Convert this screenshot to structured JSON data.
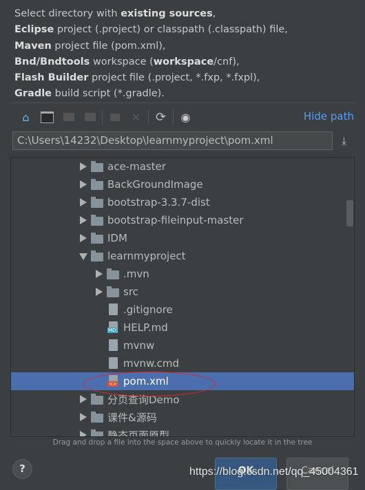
{
  "description": [
    [
      {
        "t": "Select directory with ",
        "b": false
      },
      {
        "t": "existing sources",
        "b": true
      },
      {
        "t": ",",
        "b": false
      }
    ],
    [
      {
        "t": "Eclipse",
        "b": true
      },
      {
        "t": " project (.project) or classpath (.classpath) file,",
        "b": false
      }
    ],
    [
      {
        "t": "Maven",
        "b": true
      },
      {
        "t": " project file (pom.xml),",
        "b": false
      }
    ],
    [
      {
        "t": "Bnd/Bndtools",
        "b": true
      },
      {
        "t": " workspace (",
        "b": false
      },
      {
        "t": "workspace",
        "b": true
      },
      {
        "t": "/cnf),",
        "b": false
      }
    ],
    [
      {
        "t": "Flash Builder",
        "b": true
      },
      {
        "t": " project file (.project, *.fxp, *.fxpl),",
        "b": false
      }
    ],
    [
      {
        "t": "Gradle",
        "b": true
      },
      {
        "t": " build script (*.gradle).",
        "b": false
      }
    ]
  ],
  "toolbar": {
    "hide_path": "Hide path"
  },
  "path_value": "C:\\Users\\14232\\Desktop\\learnmyproject\\pom.xml",
  "tree": [
    {
      "label": "ace-master",
      "level": 1,
      "type": "folder",
      "expanded": false
    },
    {
      "label": "BackGroundImage",
      "level": 1,
      "type": "folder",
      "expanded": false
    },
    {
      "label": "bootstrap-3.3.7-dist",
      "level": 1,
      "type": "folder",
      "expanded": false
    },
    {
      "label": "bootstrap-fileinput-master",
      "level": 1,
      "type": "folder",
      "expanded": false
    },
    {
      "label": "IDM",
      "level": 1,
      "type": "folder",
      "expanded": false
    },
    {
      "label": "learnmyproject",
      "level": 1,
      "type": "folder",
      "expanded": true
    },
    {
      "label": ".mvn",
      "level": 2,
      "type": "folder",
      "expanded": false
    },
    {
      "label": "src",
      "level": 2,
      "type": "folder",
      "expanded": false
    },
    {
      "label": ".gitignore",
      "level": 2,
      "type": "file"
    },
    {
      "label": "HELP.md",
      "level": 2,
      "type": "md"
    },
    {
      "label": "mvnw",
      "level": 2,
      "type": "file"
    },
    {
      "label": "mvnw.cmd",
      "level": 2,
      "type": "file"
    },
    {
      "label": "pom.xml",
      "level": 2,
      "type": "xml",
      "selected": true
    },
    {
      "label": "分页查询Demo",
      "level": 1,
      "type": "folder",
      "expanded": false
    },
    {
      "label": "课件&源码",
      "level": 1,
      "type": "folder",
      "expanded": false
    },
    {
      "label": "静态页面原型",
      "level": 1,
      "type": "folder",
      "expanded": false
    }
  ],
  "hint": "Drag and drop a file into the space above to quickly locate it in the tree",
  "buttons": {
    "help": "?",
    "ok": "OK",
    "cancel": "Cancel"
  },
  "watermark": "https://blog.csdn.net/qq_45004361",
  "colors": {
    "selection": "#4b6eaf",
    "link": "#589df6",
    "annotation": "#e0262c"
  }
}
